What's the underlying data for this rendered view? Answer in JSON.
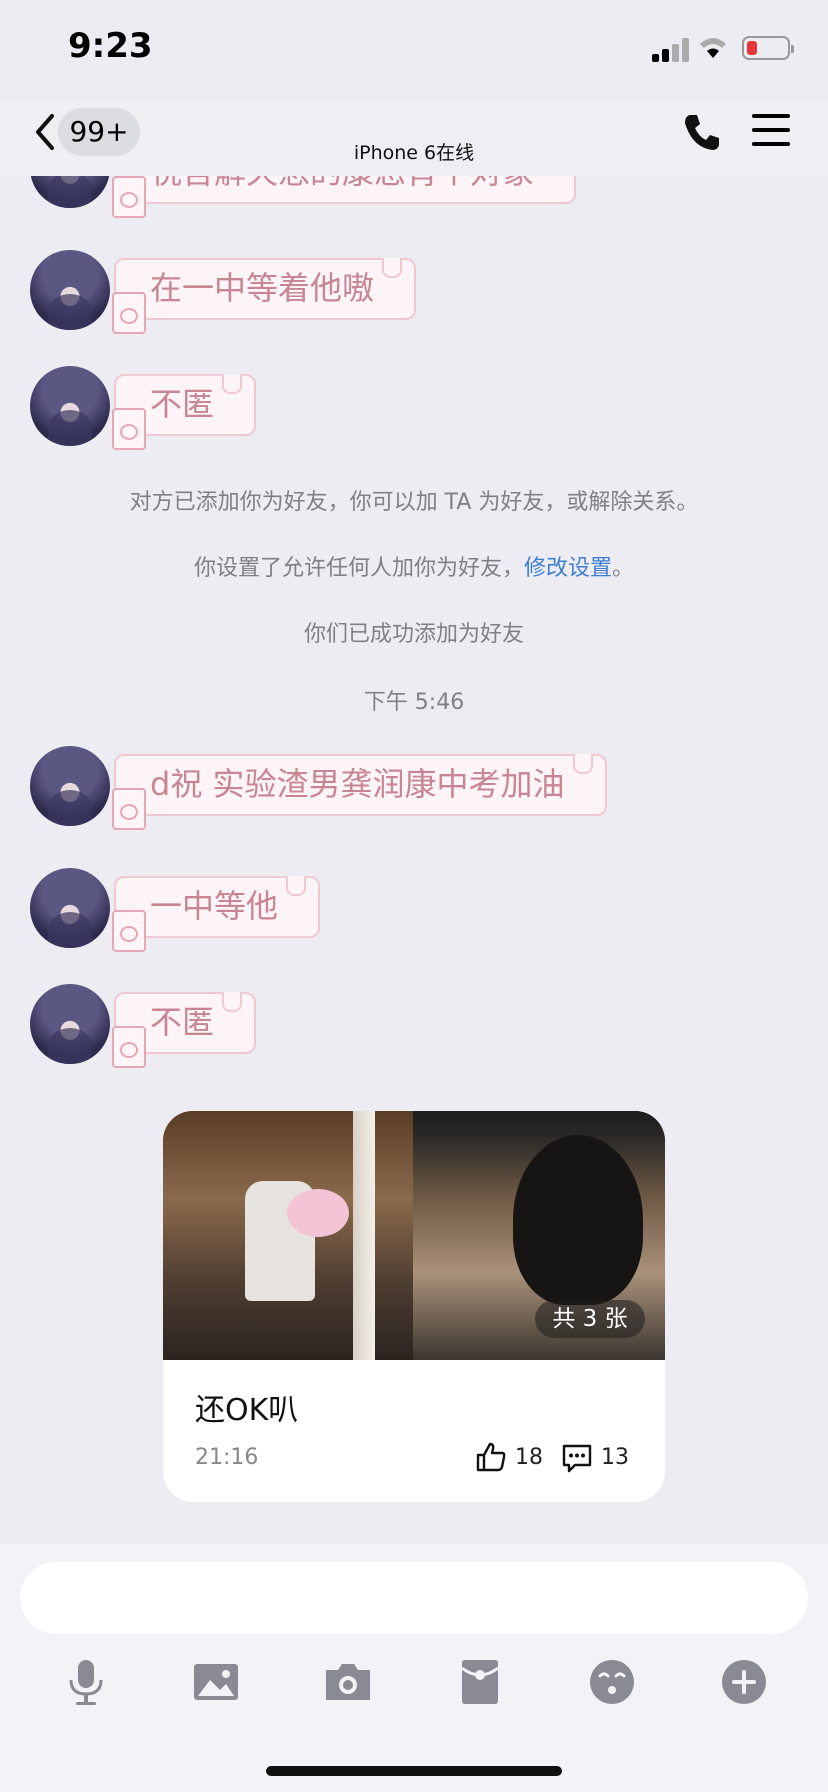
{
  "status_bar": {
    "time": "9:23"
  },
  "nav": {
    "unread_badge": "99+",
    "title": "iPhone 6在线"
  },
  "messages": [
    {
      "text": "祝吾解天悉的康您宵个对象"
    },
    {
      "text": "在一中等着他嗷"
    },
    {
      "text": "不匿"
    },
    {
      "text": "d祝 实验渣男龚润康中考加油"
    },
    {
      "text": "一中等他"
    },
    {
      "text": "不匿"
    }
  ],
  "system_notices": {
    "added_friend": "对方已添加你为好友，你可以加 TA 为好友，或解除关系。",
    "permission_prefix": "你设置了允许任何人加你为好友，",
    "permission_link": "修改设置",
    "permission_suffix": "。",
    "success": "你们已成功添加为好友",
    "timestamp": "下午 5:46"
  },
  "shared_card": {
    "image_count": "共 3 张",
    "title": "还OK叭",
    "time": "21:16",
    "likes": "18",
    "comments": "13"
  },
  "input": {
    "placeholder": ""
  },
  "toolbar": [
    "microphone-icon",
    "image-icon",
    "camera-icon",
    "red-packet-icon",
    "emoji-icon",
    "plus-icon"
  ]
}
